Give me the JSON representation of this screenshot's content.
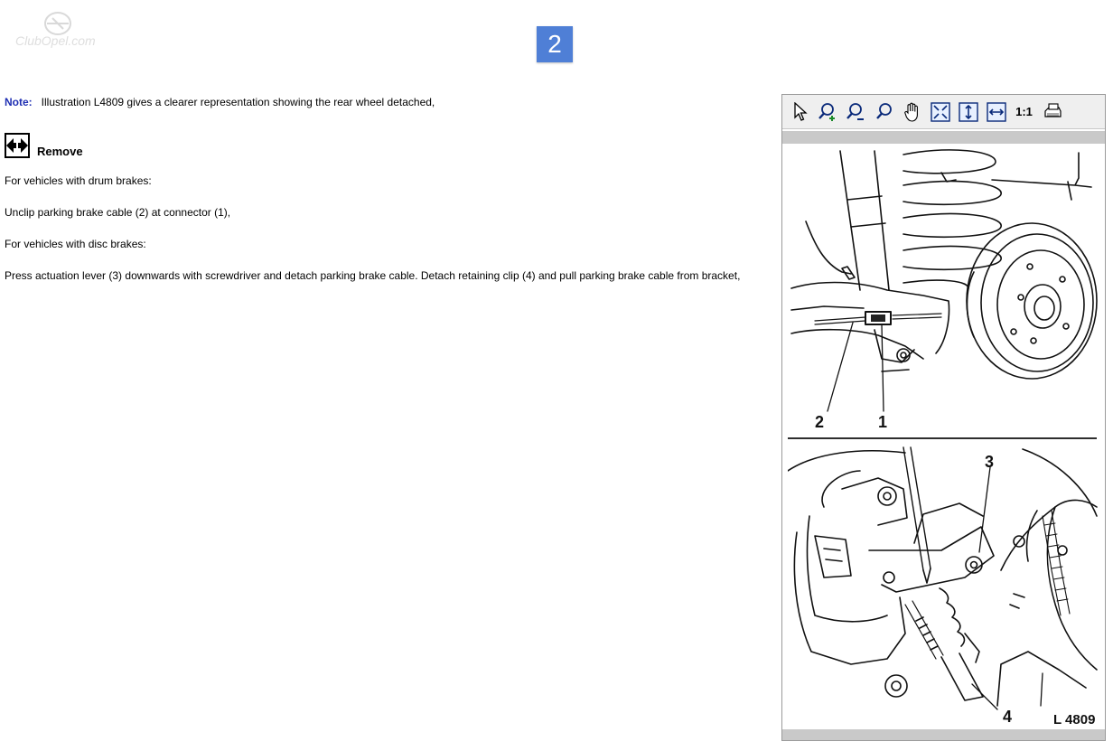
{
  "page": {
    "step_number": "2"
  },
  "note": {
    "label": "Note:",
    "text": "Illustration L4809 gives a clearer representation showing the rear wheel detached,"
  },
  "section": {
    "remove_label": "Remove",
    "icon": "remove-arrows-icon"
  },
  "paragraphs": [
    "For vehicles with drum brakes:",
    "Unclip parking brake cable (2) at connector (1),",
    "For vehicles with disc brakes:",
    "Press actuation lever (3) downwards with screwdriver and detach parking brake cable. Detach retaining clip (4) and pull parking brake cable from bracket,"
  ],
  "viewer": {
    "toolbar": [
      {
        "name": "select-pointer-icon"
      },
      {
        "name": "zoom-in-icon"
      },
      {
        "name": "zoom-out-icon"
      },
      {
        "name": "zoom-icon"
      },
      {
        "name": "pan-hand-icon"
      },
      {
        "name": "fit-page-icon"
      },
      {
        "name": "fit-height-icon"
      },
      {
        "name": "fit-width-icon"
      },
      {
        "name": "actual-size-button",
        "label": "1:1"
      },
      {
        "name": "print-icon"
      }
    ],
    "callouts": {
      "c1": "1",
      "c2": "2",
      "c3": "3",
      "c4": "4"
    },
    "figure_id": "L 4809"
  },
  "colors": {
    "note_label": "#1f2fb3",
    "step_badge": "#4f7fd6",
    "toolbar_icon": "#0a2a7a",
    "zoom_plus": "#1c8a2a"
  }
}
